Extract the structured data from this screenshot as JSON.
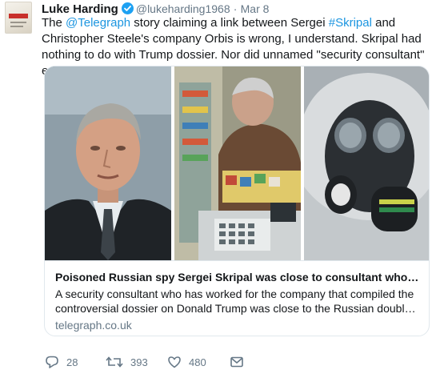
{
  "tweet": {
    "author_name": "Luke Harding",
    "handle": "@lukeharding1968",
    "separator": "·",
    "date": "Mar 8",
    "text_parts": {
      "p1": "The ",
      "mention": "@Telegraph",
      "p2": " story claiming a link between Sergei ",
      "hashtag": "#Skripal",
      "p3": " and Christopher Steele's company Orbis is wrong, I understand. Skripal had nothing to do with Trump dossier. Nor did unnamed \"security consultant\" ever work for Orbis"
    },
    "avatar_icon": "book-cover-avatar",
    "verified_icon": "verified-badge-icon"
  },
  "card": {
    "title": "Poisoned Russian spy Sergei Skripal was close to consultant who w...",
    "description_line1": "A security consultant who has worked for the company that compiled the",
    "description_line2": "controversial dossier on Donald Trump was close to the Russian double a...",
    "domain": "telegraph.co.uk",
    "images": [
      "photo-man-portrait",
      "photo-cctv-shop-counter",
      "photo-gas-mask-hazmat"
    ]
  },
  "actions": {
    "reply_count": "28",
    "retweet_count": "393",
    "like_count": "480",
    "icons": [
      "reply-icon",
      "retweet-icon",
      "like-icon",
      "direct-message-icon"
    ]
  },
  "colors": {
    "link": "#1b95e0",
    "verified": "#1da1f2",
    "muted": "#657786",
    "border": "#e1e8ed"
  }
}
